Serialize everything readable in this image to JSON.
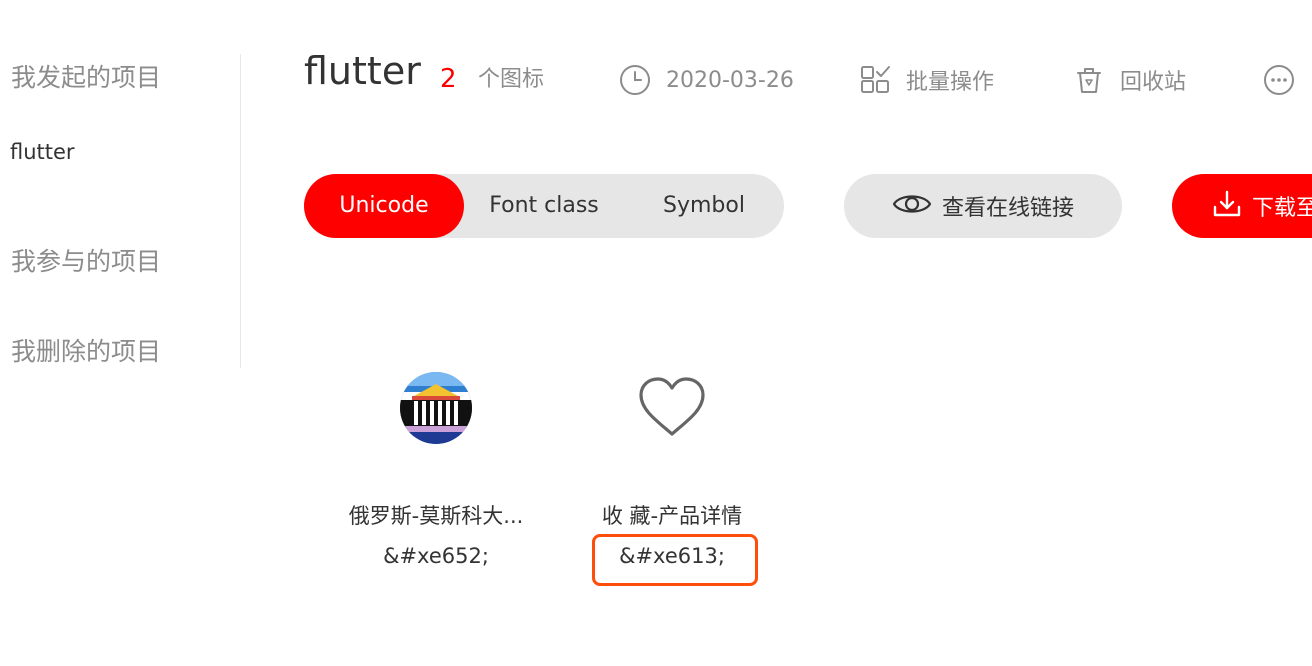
{
  "sidebar": {
    "initiated_label": "我发起的项目",
    "project_name": "flutter",
    "participated_label": "我参与的项目",
    "deleted_label": "我删除的项目"
  },
  "header": {
    "title": "flutter",
    "icon_count": "2",
    "icon_count_unit": "个图标",
    "date": "2020-03-26",
    "batch_label": "批量操作",
    "recycle_label": "回收站"
  },
  "tabs": [
    {
      "label": "Unicode",
      "active": true
    },
    {
      "label": "Font class",
      "active": false
    },
    {
      "label": "Symbol",
      "active": false
    }
  ],
  "actions": {
    "view_online_label": "查看在线链接",
    "download_label": "下载至"
  },
  "icons": [
    {
      "name": "俄罗斯-莫斯科大...",
      "code": "&#xe652;",
      "icon": "moscow-theatre-icon"
    },
    {
      "name": "收 藏-产品详情",
      "code": "&#xe613;",
      "icon": "heart-icon"
    }
  ],
  "colors": {
    "accent": "#ff0000",
    "highlight": "#ff4d0a",
    "muted_text": "#8c8c8c",
    "pill_bg": "#e6e6e6"
  }
}
